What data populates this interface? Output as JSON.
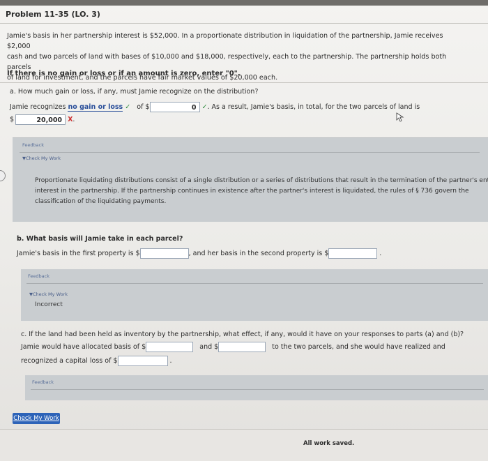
{
  "header": {
    "title": "Problem 11-35 (LO. 3)"
  },
  "problem": {
    "text_line1": "Jamie's basis in her partnership interest is $52,000. In a proportionate distribution in liquidation of the partnership, Jamie receives $2,000",
    "text_line2": "cash and two parcels of land with bases of $10,000 and $18,000, respectively, each to the partnership. The partnership holds both parcels",
    "text_line3": "of land for investment, and the parcels have fair market values of $20,000 each.",
    "rule": "If there is no gain or loss or if an amount is zero, enter \"0\"."
  },
  "part_a": {
    "question": "a.  How much gain or loss, if any, must Jamie recognize on the distribution?",
    "prefix": "Jamie recognizes",
    "select_value": "no gain or loss",
    "of_label": "of $",
    "amount_value": "0",
    "after_text": ". As a result, Jamie's basis, in total, for the two parcels of land is",
    "dollar": "$",
    "basis_value": "20,000",
    "check_mark": "✓",
    "x_mark": "X",
    "period": "."
  },
  "feedback_a": {
    "label": "Feedback",
    "check_my_work": "▼Check My Work",
    "line1": "Proportionate liquidating distributions consist of a single distribution or a series of distributions that result in the termination of the partner's entire",
    "line2": "interest in the partnership. If the partnership continues in existence after the partner's interest is liquidated, the rules of § 736 govern the",
    "line3": "classification of the liquidating payments."
  },
  "part_b": {
    "question": "b.  What basis will Jamie take in each parcel?",
    "text1": "Jamie's basis in the first property is $",
    "text2": ", and her basis in the second property is $",
    "end": "."
  },
  "feedback_b": {
    "label": "Feedback",
    "check_my_work": "▼Check My Work",
    "result": "Incorrect"
  },
  "part_c": {
    "question": "c.  If the land had been held as inventory by the partnership, what effect, if any, would it have on your responses to parts (a) and (b)?",
    "text1": "Jamie would have allocated basis of $",
    "text2": "and $",
    "text3": "to the two parcels, and she would have realized and",
    "text4": "recognized a capital loss of $",
    "end": "."
  },
  "feedback_c": {
    "label": "Feedback"
  },
  "footer": {
    "check_my_work_button": "Check My Work",
    "status": "All work saved."
  },
  "colors": {
    "link": "#2a4f9a",
    "button": "#2d63b8",
    "correct": "#2a8a3a",
    "incorrect": "#cc3333"
  }
}
